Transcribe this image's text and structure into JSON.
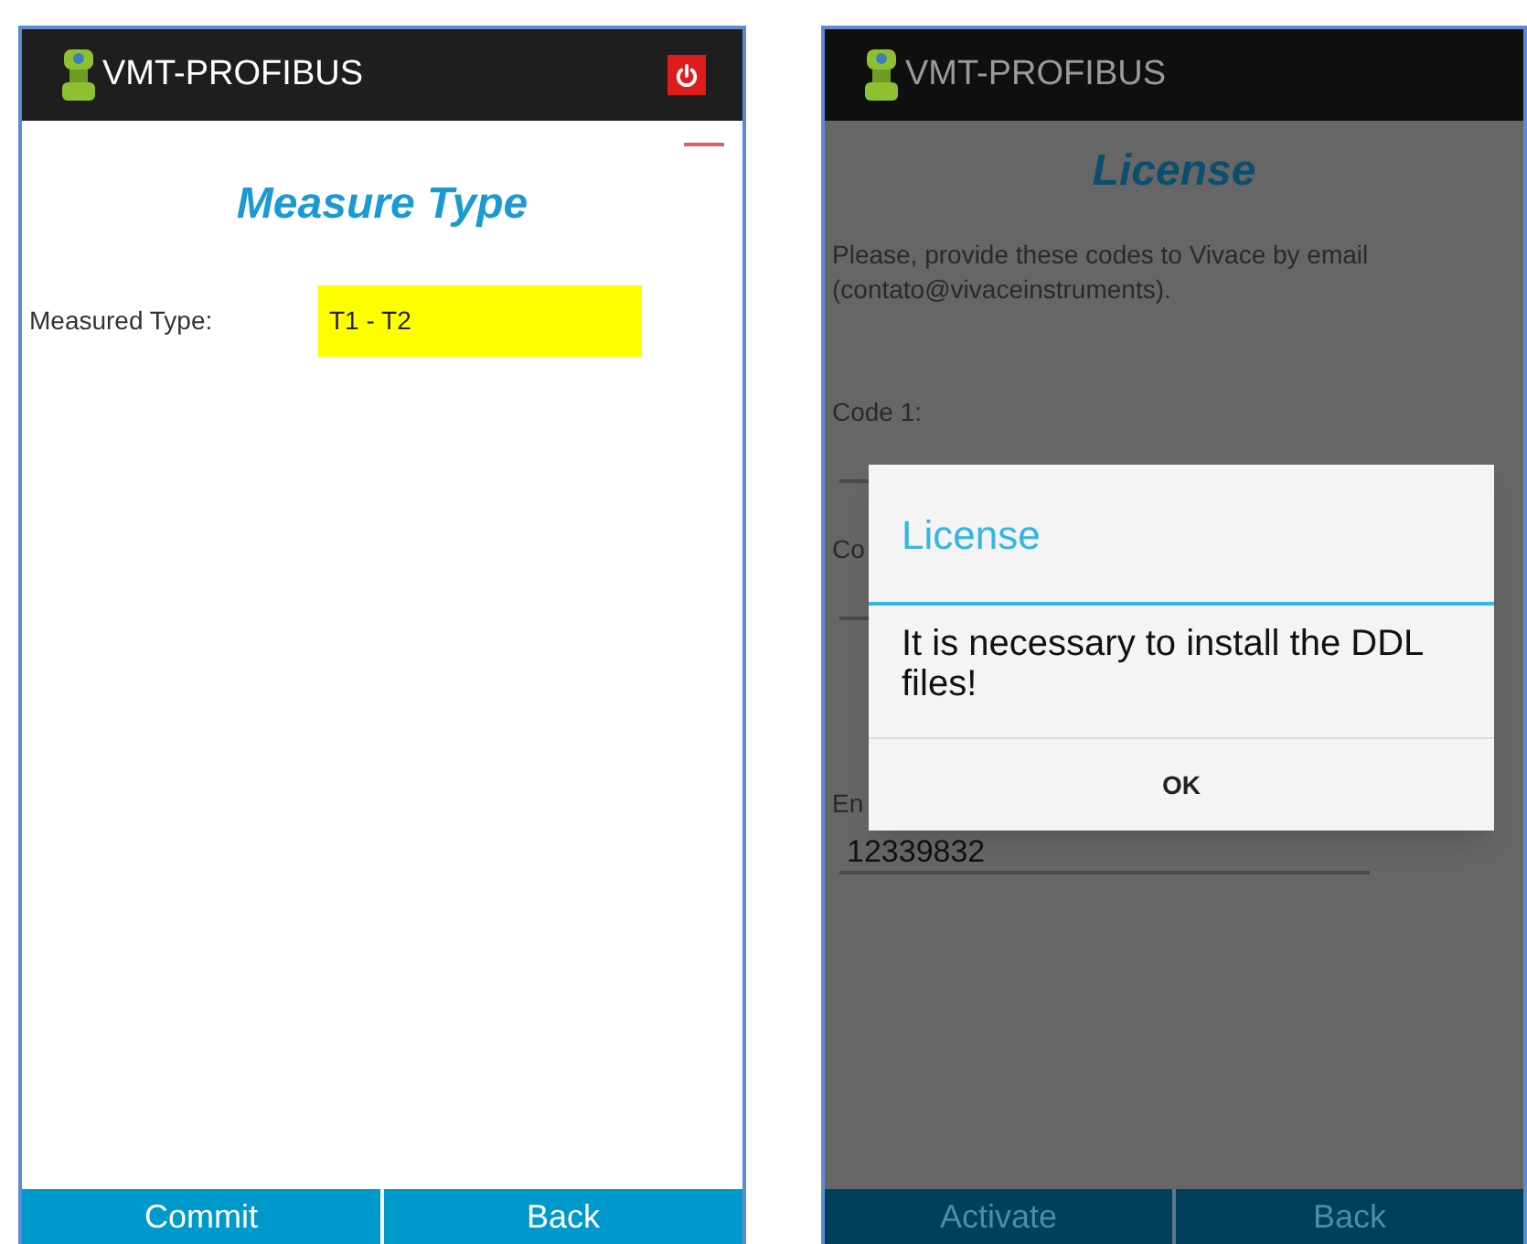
{
  "screens": [
    {
      "app_title": "VMT-PROFIBUS",
      "power_button": true,
      "title": "Measure Type",
      "fields": [
        {
          "kind": "highlight",
          "label": "Measured Type:",
          "value": "T1 - T2"
        }
      ],
      "buttons": [
        "Commit",
        "Back"
      ]
    },
    {
      "app_title": "VMT-PROFIBUS",
      "power_button": false,
      "title": "License",
      "intro": "Please, provide these codes to Vivace by email (contato@vivaceinstruments).",
      "fields": [
        {
          "kind": "underline",
          "label": "Code 1:"
        },
        {
          "kind": "underline",
          "label": "Co"
        },
        {
          "kind": "underline",
          "label": "En",
          "value": "12339832"
        }
      ],
      "buttons": [
        "Activate",
        "Back"
      ],
      "dialog": {
        "title": "License",
        "message": "It is necessary to install the DDL files!",
        "button": "OK"
      }
    }
  ]
}
